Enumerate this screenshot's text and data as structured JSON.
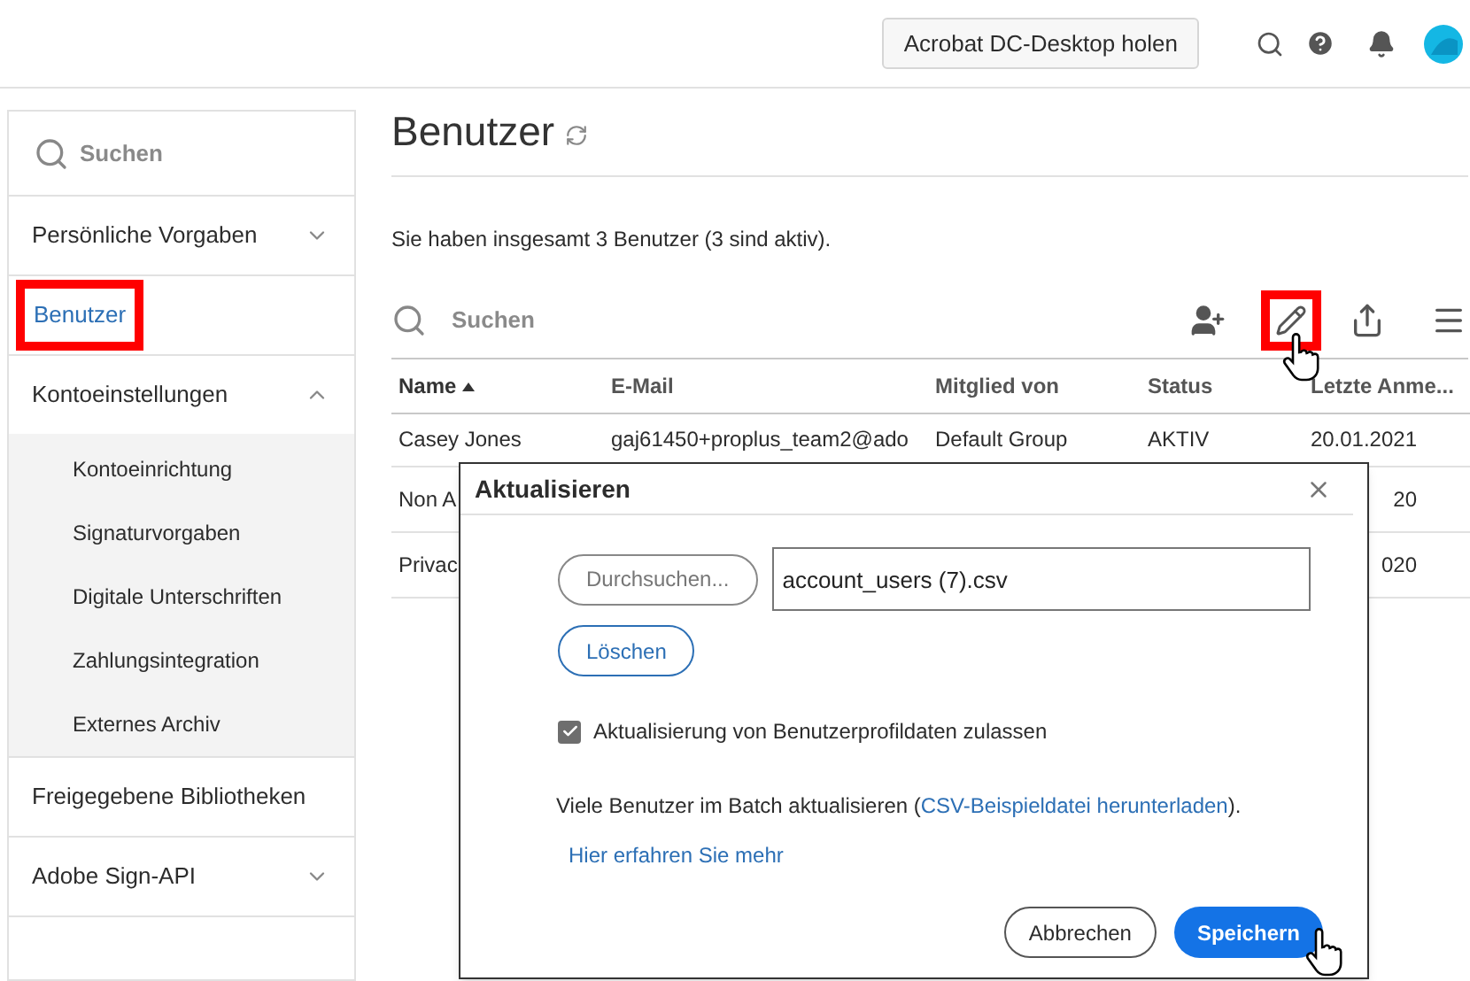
{
  "header": {
    "desktop_button": "Acrobat DC-Desktop holen"
  },
  "sidebar": {
    "search_placeholder": "Suchen",
    "items": [
      {
        "label": "Persönliche Vorgaben",
        "selected": false,
        "expanded": false,
        "highlighted": false
      },
      {
        "label": "Benutzer",
        "selected": true,
        "highlighted": true
      },
      {
        "label": "Kontoeinstellungen",
        "selected": false,
        "expanded": true,
        "highlighted": false,
        "children": [
          {
            "label": "Kontoeinrichtung"
          },
          {
            "label": "Signaturvorgaben"
          },
          {
            "label": "Digitale Unterschriften"
          },
          {
            "label": "Zahlungsintegration"
          },
          {
            "label": "Externes Archiv"
          }
        ]
      },
      {
        "label": "Freigegebene Bibliotheken",
        "selected": false,
        "highlighted": false
      },
      {
        "label": "Adobe Sign-API",
        "selected": false,
        "expanded": false,
        "highlighted": false
      }
    ]
  },
  "page": {
    "title": "Benutzer",
    "summary": "Sie haben insgesamt 3 Benutzer (3 sind aktiv).",
    "search_placeholder": "Suchen"
  },
  "table": {
    "columns": [
      {
        "label": "Name",
        "sorted": true
      },
      {
        "label": "E-Mail",
        "sorted": false
      },
      {
        "label": "Mitglied von",
        "sorted": false
      },
      {
        "label": "Status",
        "sorted": false
      },
      {
        "label": "Letzte Anme...",
        "sorted": false
      }
    ],
    "rows": [
      [
        "Casey Jones",
        "gaj61450+proplus_team2@ado",
        "Default Group",
        "AKTIV",
        "20.01.2021"
      ],
      [
        "Non A",
        "",
        "",
        "",
        "20"
      ],
      [
        "Privac",
        "",
        "",
        "",
        "020"
      ]
    ]
  },
  "dialog": {
    "title": "Aktualisieren",
    "browse_button": "Durchsuchen...",
    "file_value": "account_users (7).csv",
    "clear_button": "Löschen",
    "allow_update": {
      "label": "Aktualisierung von Benutzerprofildaten zulassen",
      "checked": true
    },
    "batch_text": "Viele Benutzer im Batch aktualisieren (",
    "batch_link": "CSV-Beispieldatei herunterladen",
    "batch_end": ").",
    "learn_more": "Hier erfahren Sie mehr",
    "cancel_button": "Abbrechen",
    "save_button": "Speichern"
  }
}
